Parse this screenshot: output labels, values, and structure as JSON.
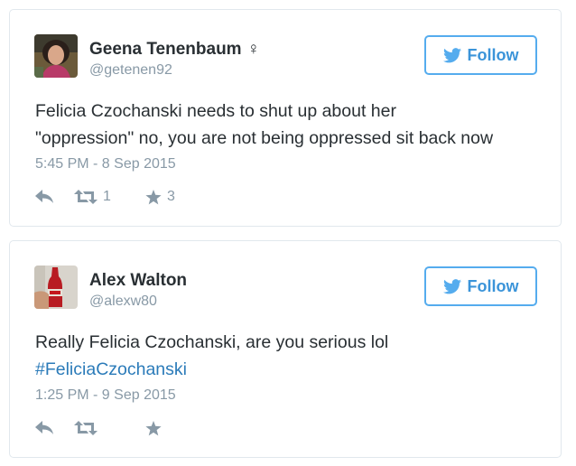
{
  "tweets": [
    {
      "display_name": "Geena Tenenbaum",
      "gender_symbol": "♀",
      "handle": "@getenen92",
      "follow_label": "Follow",
      "text_lines": [
        "Felicia Czochanski needs to shut up about her",
        "\"oppression\" no, you are not being oppressed sit back now"
      ],
      "timestamp": "5:45 PM - 8 Sep 2015",
      "retweet_count": "1",
      "like_count": "3",
      "icons": {
        "reply": "reply-icon",
        "retweet": "retweet-icon",
        "like": "star-icon",
        "follow": "twitter-bird-icon"
      }
    },
    {
      "display_name": "Alex Walton",
      "handle": "@alexw80",
      "follow_label": "Follow",
      "text_line1": "Really Felicia Czochanski, are you serious lol",
      "hashtag": "#FeliciaCzochanski",
      "timestamp": "1:25 PM - 9 Sep 2015",
      "icons": {
        "reply": "reply-icon",
        "retweet": "retweet-icon",
        "like": "star-icon",
        "follow": "twitter-bird-icon"
      }
    }
  ],
  "colors": {
    "twitter_blue": "#55acee",
    "follow_text": "#3b94d9",
    "hashtag": "#2b7bb9",
    "muted": "#8899a6",
    "text": "#292f33",
    "border": "#e1e8ed"
  }
}
